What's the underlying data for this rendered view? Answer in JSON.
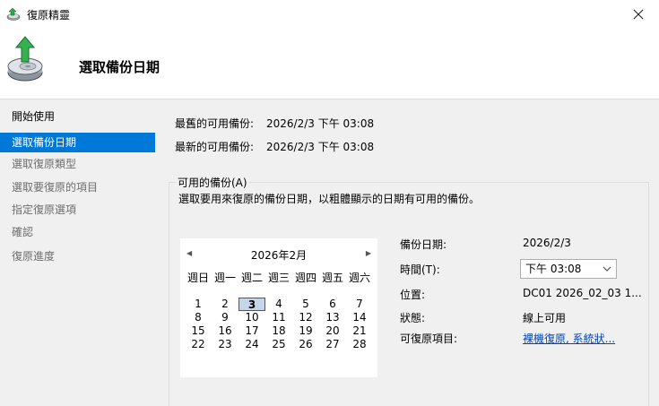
{
  "window": {
    "title": "復原精靈",
    "close_glyph": "✕"
  },
  "header": {
    "title": "選取備份日期"
  },
  "sidebar": {
    "items": [
      {
        "label": "開始使用",
        "state": "done"
      },
      {
        "label": "選取備份日期",
        "state": "active"
      },
      {
        "label": "選取復原類型",
        "state": "pending"
      },
      {
        "label": "選取要復原的項目",
        "state": "pending"
      },
      {
        "label": "指定復原選項",
        "state": "pending"
      },
      {
        "label": "確認",
        "state": "pending"
      },
      {
        "label": "復原進度",
        "state": "pending"
      }
    ]
  },
  "summary": {
    "oldest_label": "最舊的可用備份:",
    "oldest_value": "2026/2/3 下午 03:08",
    "newest_label": "最新的可用備份:",
    "newest_value": "2026/2/3 下午 03:08"
  },
  "group": {
    "legend": "可用的備份(A)",
    "description": "選取要用來復原的備份日期，以粗體顯示的日期有可用的備份。"
  },
  "calendar": {
    "prev_glyph": "◀",
    "next_glyph": "▶",
    "month_title": "2026年2月",
    "weekdays": [
      "週日",
      "週一",
      "週二",
      "週三",
      "週四",
      "週五",
      "週六"
    ],
    "selected_day": 3,
    "weeks": [
      [
        "1",
        "2",
        "3",
        "4",
        "5",
        "6",
        "7"
      ],
      [
        "8",
        "9",
        "10",
        "11",
        "12",
        "13",
        "14"
      ],
      [
        "15",
        "16",
        "17",
        "18",
        "19",
        "20",
        "21"
      ],
      [
        "22",
        "23",
        "24",
        "25",
        "26",
        "27",
        "28"
      ]
    ]
  },
  "details": {
    "date_label": "備份日期:",
    "date_value": "2026/2/3",
    "time_label": "時間(T):",
    "time_value": "下午 03:08",
    "location_label": "位置:",
    "location_value": "DC01 2026_02_03 1...",
    "status_label": "狀態:",
    "status_value": "線上可用",
    "items_label": "可復原項目:",
    "items_value": "裸機復原, 系統狀..."
  },
  "colors": {
    "accent": "#0078d7",
    "link": "#0645ad",
    "panel": "#f0f0f0"
  },
  "icons": {
    "title": "recovery-wizard-icon",
    "header": "disk-recovery-icon"
  }
}
